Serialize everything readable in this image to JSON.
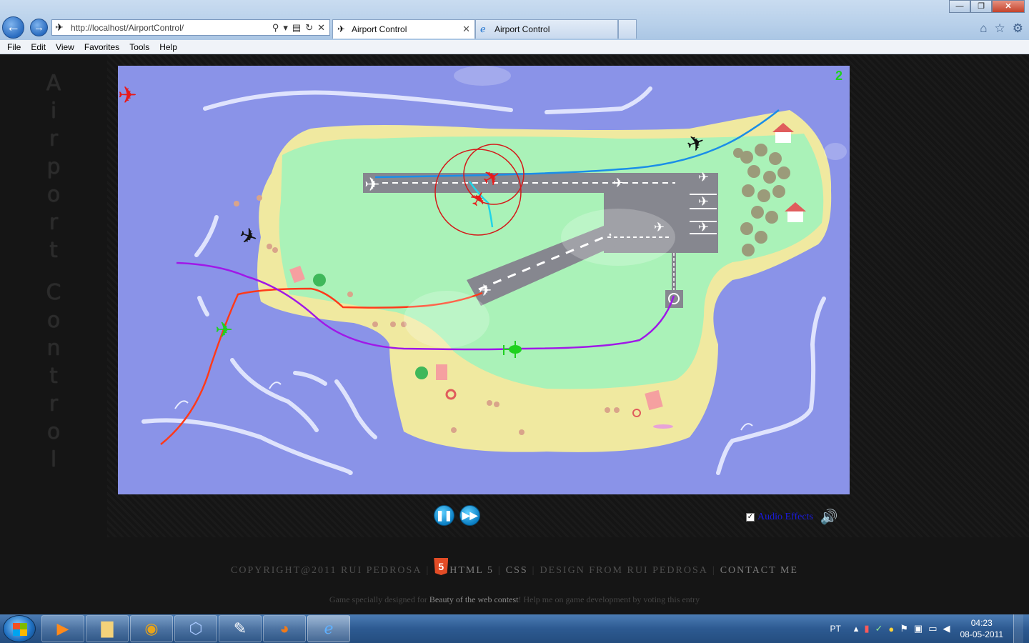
{
  "browser": {
    "url": "http://localhost/AirportControl/",
    "tabs": [
      {
        "label": "Airport Control",
        "active": true
      },
      {
        "label": "Airport Control",
        "active": false
      }
    ],
    "menu": [
      "File",
      "Edit",
      "View",
      "Favorites",
      "Tools",
      "Help"
    ]
  },
  "page": {
    "vertical_title": [
      "A",
      "i",
      "r",
      "p",
      "o",
      "r",
      "t",
      "",
      "C",
      "o",
      "n",
      "t",
      "r",
      "o",
      "l"
    ],
    "score": "2",
    "controls": {
      "pause_icon": "pause-icon",
      "fast_forward_icon": "fast-forward-icon",
      "audio_label": "Audio Effects",
      "audio_checked": true
    },
    "footer": {
      "copyright": "COPYRIGHT@2011 RUI PEDROSA",
      "html5": "HTML 5",
      "css": "CSS",
      "design": "DESIGN FROM RUI PEDROSA",
      "contact": "CONTACT ME",
      "sub_before": "Game specially designed for ",
      "sub_link": "Beauty of the web contest",
      "sub_after": "! Help me on game development by voting this entry"
    }
  },
  "taskbar": {
    "apps": [
      "media-player-icon",
      "explorer-icon",
      "chrome-icon",
      "virtualbox-icon",
      "notepad-icon",
      "firefox-icon",
      "ie-icon"
    ],
    "language": "PT",
    "time": "04:23",
    "date": "08-05-2011"
  },
  "colors": {
    "sea": "#8a93e8",
    "beach": "#f0e9a0",
    "grass": "#aaf2b8",
    "runway": "#86878f",
    "score": "#1fd11f",
    "route_blue": "#1a8ee8",
    "route_red": "#ff3a1a",
    "route_purple": "#a018e8"
  }
}
